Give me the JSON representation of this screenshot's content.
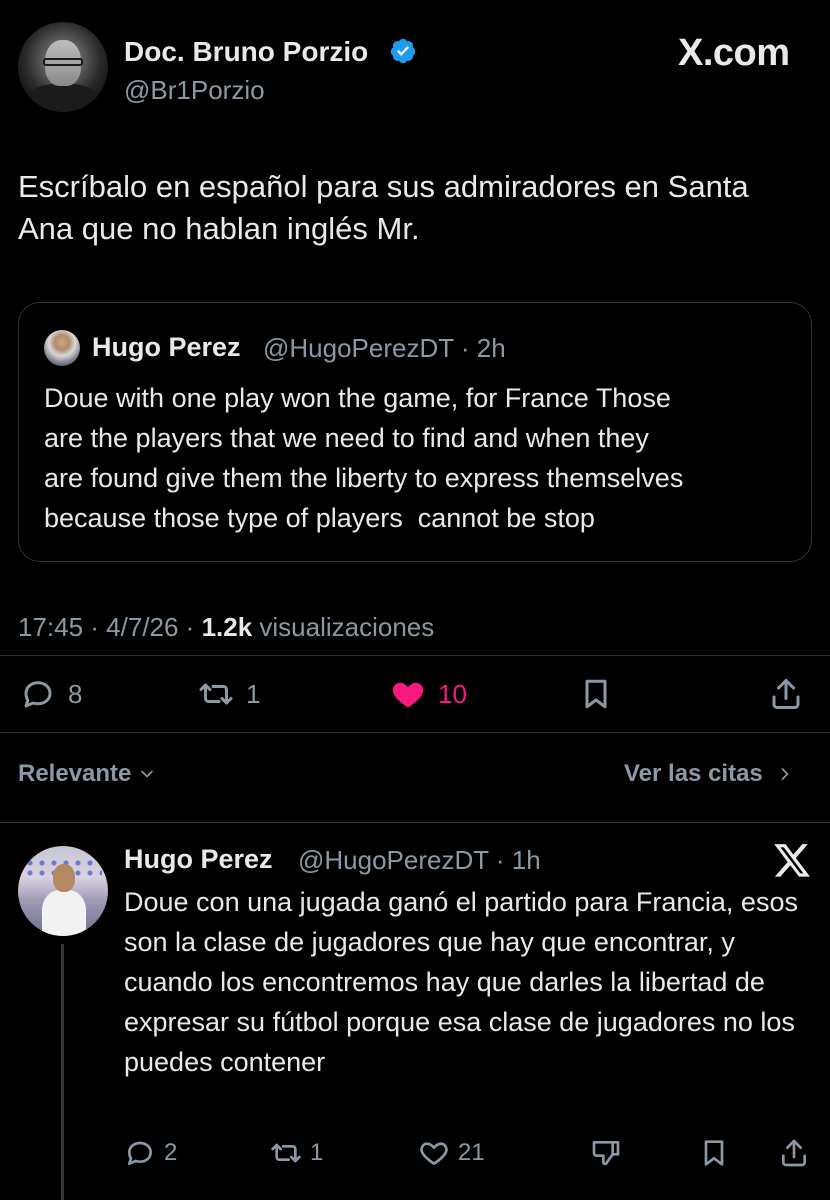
{
  "author": {
    "display_name": "Doc. Bruno Porzio",
    "handle": "@Br1Porzio",
    "verified_icon": "verified-badge-icon",
    "verified_color": "#1d9bf0"
  },
  "site_logo": "X.com",
  "tweet": {
    "text": "Escríbalo en español para sus admiradores en Santa Ana que no hablan inglés Mr."
  },
  "quote": {
    "name": "Hugo Perez",
    "meta": "@HugoPerezDT · 2h",
    "text": "Doue with one play won the game, for France Those\nare the players that we need to find and when they\nare found give them the liberty to express themselves\nbecause those type of players  cannot be stop"
  },
  "meta": {
    "time": "17:45 · 4/7/26 · ",
    "views_count": "1.2k",
    "views_label": " visualizaciones"
  },
  "actions": {
    "replies": "8",
    "reposts": "1",
    "likes": "10",
    "like_color": "#f91880"
  },
  "sort": {
    "label": "Relevante",
    "quotes_link": "Ver las citas"
  },
  "reply": {
    "name": "Hugo Perez",
    "meta": "@HugoPerezDT · 1h",
    "text": "Doue con una jugada ganó el partido para Francia, esos son la clase de jugadores que hay que encontrar, y cuando los encontremos hay que darles la libertad de expresar su fútbol porque esa clase de jugadores no los puedes contener",
    "replies": "2",
    "reposts": "1",
    "likes": "21"
  }
}
